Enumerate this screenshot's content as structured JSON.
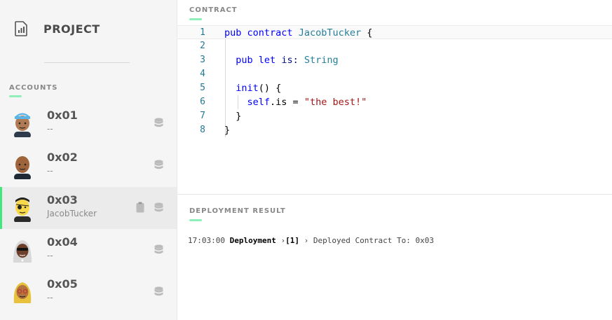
{
  "project": {
    "title": "PROJECT",
    "icon": "chart-document-icon"
  },
  "accounts": {
    "label": "ACCOUNTS",
    "items": [
      {
        "address": "0x01",
        "contract": "--",
        "avatar": "avatar-blue-cap",
        "active": false
      },
      {
        "address": "0x02",
        "contract": "--",
        "avatar": "avatar-bald",
        "active": false
      },
      {
        "address": "0x03",
        "contract": "JacobTucker",
        "avatar": "avatar-yellow-eyepatch",
        "active": true
      },
      {
        "address": "0x04",
        "contract": "--",
        "avatar": "avatar-sunglasses-hood",
        "active": false
      },
      {
        "address": "0x05",
        "contract": "--",
        "avatar": "avatar-yellow-hair-glasses",
        "active": false
      }
    ]
  },
  "contract": {
    "label": "CONTRACT",
    "line_numbers": [
      "1",
      "2",
      "3",
      "4",
      "5",
      "6",
      "7",
      "8"
    ],
    "lines": [
      {
        "kw1": "pub",
        "kw2": "contract",
        "name": "JacobTucker",
        "brace": "{"
      },
      {},
      {
        "kw1": "pub",
        "kw2": "let",
        "field": "is:",
        "type": "String"
      },
      {},
      {
        "fn": "init",
        "rest": "() {"
      },
      {
        "self": "self",
        "member": ".is = ",
        "str": "\"the best!\""
      },
      {
        "brace": "}"
      },
      {
        "brace": "}"
      }
    ]
  },
  "deployment": {
    "label": "DEPLOYMENT RESULT",
    "time": "17:03:00",
    "kind": "Deployment",
    "sep1": "›",
    "index": "[1]",
    "sep2": "›",
    "message": "Deployed Contract To: 0x03"
  },
  "colors": {
    "accent": "#3ee87a",
    "underline": "#8ef0b8",
    "keyword": "#0000ff",
    "type": "#267f99",
    "string": "#a31515"
  }
}
